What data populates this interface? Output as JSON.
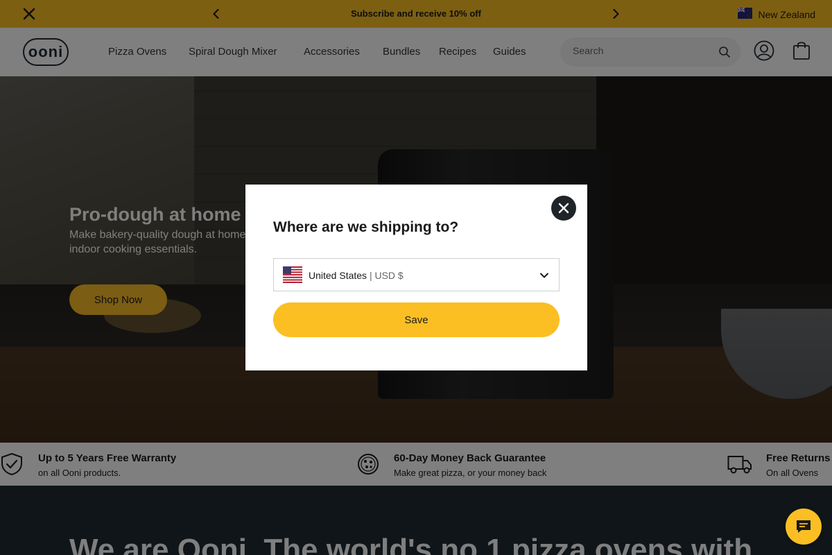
{
  "announcement": {
    "message": "Subscribe and receive 10% off",
    "region": "New Zealand",
    "bg_color": "#fbbf24"
  },
  "header": {
    "logo_text": "ooni",
    "nav": [
      "Pizza Ovens",
      "Spiral Dough Mixer",
      "Accessories",
      "Bundles",
      "Recipes",
      "Guides"
    ],
    "search_placeholder": "Search"
  },
  "hero": {
    "title": "Pro-dough at home",
    "subtitle": "Make bakery-quality dough at home and indoor cooking essentials.",
    "cta": "Shop Now"
  },
  "features": [
    {
      "title": "Up to 5 Years Free Warranty",
      "subtitle": "on all Ooni products.",
      "icon": "shield-check-icon"
    },
    {
      "title": "60-Day Money Back Guarantee",
      "subtitle": "Make great pizza, or your money back",
      "icon": "pizza-icon"
    },
    {
      "title": "Free Returns",
      "subtitle": "On all Ovens",
      "icon": "delivery-truck-icon"
    }
  ],
  "about": {
    "headline": "We are Ooni. The world's no.1 pizza ovens with"
  },
  "modal": {
    "title": "Where are we shipping to?",
    "country": "United States",
    "currency": " | USD $",
    "save_label": "Save"
  },
  "colors": {
    "accent": "#fbbf24",
    "dark_navy": "#1f2a33"
  }
}
